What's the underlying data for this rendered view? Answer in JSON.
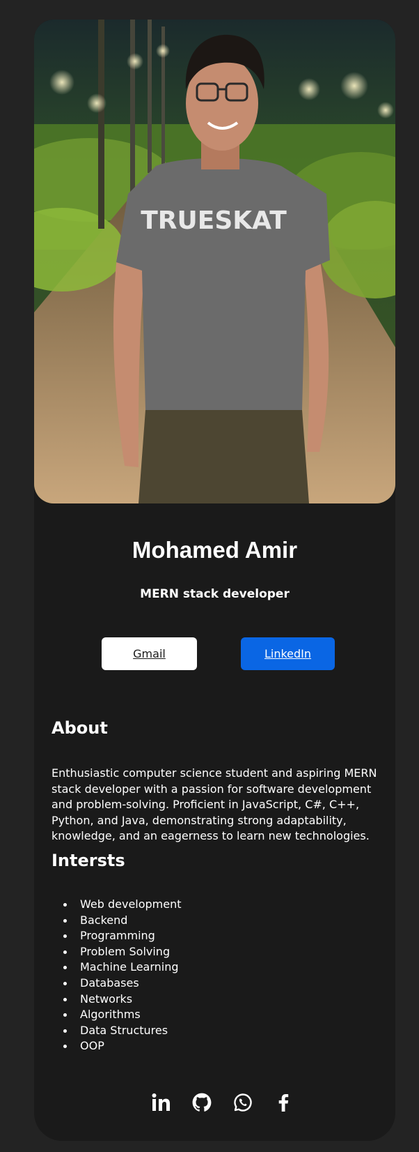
{
  "profile": {
    "name": "Mohamed Amir",
    "role": "MERN stack developer",
    "photo_shirt_text": "TRUESKAT"
  },
  "buttons": {
    "gmail": "Gmail",
    "linkedin": "LinkedIn"
  },
  "about": {
    "title": "About",
    "text": "Enthusiastic computer science student and aspiring MERN stack developer with a passion for software development and problem-solving. Proficient in JavaScript, C#, C++, Python, and Java, demonstrating strong adaptability, knowledge, and an eagerness to learn new technologies."
  },
  "interests": {
    "title": "Intersts",
    "items": [
      "Web development",
      "Backend",
      "Programming",
      "Problem Solving",
      "Machine Learning",
      "Databases",
      "Networks",
      "Algorithms",
      "Data Structures",
      "OOP"
    ]
  },
  "socials": [
    {
      "icon": "linkedin-icon"
    },
    {
      "icon": "github-icon"
    },
    {
      "icon": "whatsapp-icon"
    },
    {
      "icon": "facebook-icon"
    }
  ],
  "colors": {
    "page_bg": "#232323",
    "card_bg": "#1a1a1a",
    "linkedin_blue": "#0a66e4",
    "text": "#ffffff"
  }
}
